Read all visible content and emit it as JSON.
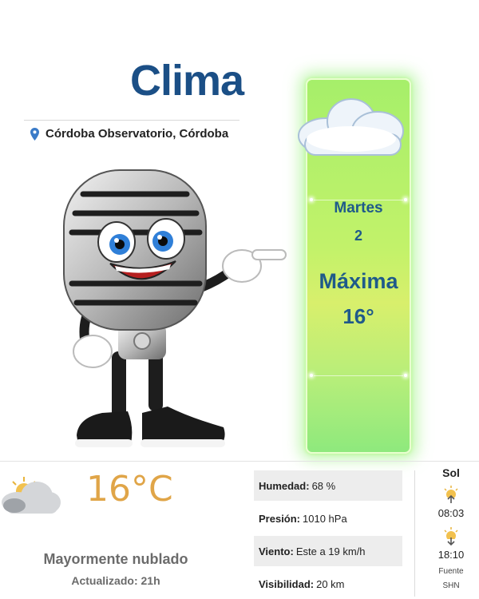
{
  "header": {
    "title": "Clima",
    "location": "Córdoba Observatorio, Córdoba"
  },
  "forecast_card": {
    "day_name": "Martes",
    "day_number": "2",
    "label": "Máxima",
    "value": "16°"
  },
  "current": {
    "temperature": "16°C",
    "condition": "Mayormente nublado",
    "updated": "Actualizado: 21h"
  },
  "stats": [
    {
      "label": "Humedad:",
      "value": "68 %"
    },
    {
      "label": "Presión:",
      "value": "1010 hPa"
    },
    {
      "label": "Viento:",
      "value": "Este a 19 km/h"
    },
    {
      "label": "Visibilidad:",
      "value": "20 km"
    }
  ],
  "sun": {
    "title": "Sol",
    "sunrise": "08:03",
    "sunset": "18:10",
    "source_label": "Fuente",
    "source_name": "SHN"
  },
  "colors": {
    "title_blue": "#1b4f86",
    "temp_orange": "#e0a548",
    "bar_green": "#b7ee7a"
  },
  "icons": [
    "location-pin-icon",
    "cloud-icon",
    "partly-cloudy-icon",
    "sunrise-icon",
    "sunset-icon"
  ]
}
